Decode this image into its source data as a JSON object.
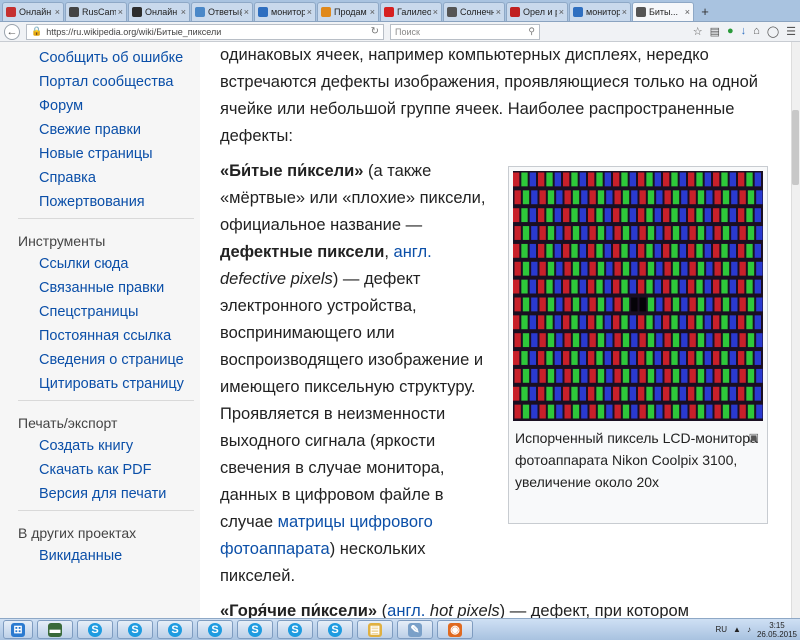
{
  "tabs": [
    {
      "label": "Онлайн ...",
      "icon": "video-icon",
      "color": "#c53030"
    },
    {
      "label": "RusCams - M...",
      "icon": "camera-icon",
      "color": "#444444"
    },
    {
      "label": "Онлайн ...",
      "icon": "video-icon",
      "color": "#2d2d2d"
    },
    {
      "label": "Ответы@...",
      "icon": "question-icon",
      "color": "#4a88c8"
    },
    {
      "label": "монитор...",
      "icon": "search-icon",
      "color": "#2f6fc0"
    },
    {
      "label": "Продам ...",
      "icon": "ad-icon",
      "color": "#e0891b"
    },
    {
      "label": "Галилео...",
      "icon": "youtube-icon",
      "color": "#d62020"
    },
    {
      "label": "Солнечн...",
      "icon": "wikipedia-icon",
      "color": "#555555"
    },
    {
      "label": "Орел и р...",
      "icon": "news-icon",
      "color": "#c02020"
    },
    {
      "label": "монитор...",
      "icon": "search-icon",
      "color": "#2f6fc0"
    },
    {
      "label": "Биты...",
      "icon": "wikipedia-icon",
      "color": "#555555"
    }
  ],
  "url": "https://ru.wikipedia.org/wiki/Битые_пиксели",
  "search_placeholder": "Поиск",
  "sidebar": {
    "top_links": [
      "Сообщить об ошибке",
      "Портал сообщества",
      "Форум",
      "Свежие правки",
      "Новые страницы",
      "Справка",
      "Пожертвования"
    ],
    "sections": [
      {
        "heading": "Инструменты",
        "links": [
          "Ссылки сюда",
          "Связанные правки",
          "Спецстраницы",
          "Постоянная ссылка",
          "Сведения о странице",
          "Цитировать страницу"
        ]
      },
      {
        "heading": "Печать/экспорт",
        "links": [
          "Создать книгу",
          "Скачать как PDF",
          "Версия для печати"
        ]
      },
      {
        "heading": "В других проектах",
        "links": [
          "Викиданные"
        ]
      }
    ]
  },
  "article": {
    "intro": "одинаковых ячеек, например компьютерных дисплеях, нередко встречаются дефекты изображения, проявляющиеся только на одной ячейке или небольшой группе ячеек. Наиболее распространенные дефекты:",
    "p1": {
      "term": "«Би́тые пи́ксели»",
      "t1": " (а также «мёртвые» или «плохие» пиксели, официальное название — ",
      "bold2": "дефектные пиксели",
      "t2": ", ",
      "link1": "англ.",
      "it1": " defective pixels",
      "t3": ") — дефект электронного устройства, воспринимающего или воспроизводящего изображение и имеющего пиксельную структуру. Проявляется в неизменности выходного сигнала (яркости свечения в случае монитора, данных в цифровом файле в случае ",
      "link2": "матрицы цифрового фотоаппарата",
      "t4": ") нескольких пикселей."
    },
    "p2": {
      "term": "«Горя́чие пи́ксели»",
      "t1": " (",
      "link1": "англ.",
      "it1": " hot pixels",
      "t2": ") — дефект, при котором"
    }
  },
  "figure": {
    "caption": "Испорченный пиксель LCD-монитора фотоаппарата Nikon Coolpix 3100, увеличение около 20x",
    "colors": {
      "red": "#c8202a",
      "green": "#2ec83a",
      "blue": "#2a3ad0",
      "bg": "#1a0f22"
    }
  },
  "taskbar": {
    "apps": [
      "start-button",
      "terminal-icon",
      "skype-icon",
      "skype-icon",
      "skype-icon",
      "skype-icon",
      "skype-icon",
      "skype-icon",
      "skype-icon",
      "folder-icon",
      "notepad-icon",
      "firefox-icon"
    ],
    "lang": "RU",
    "time": "3:15",
    "date": "26.05.2015"
  }
}
